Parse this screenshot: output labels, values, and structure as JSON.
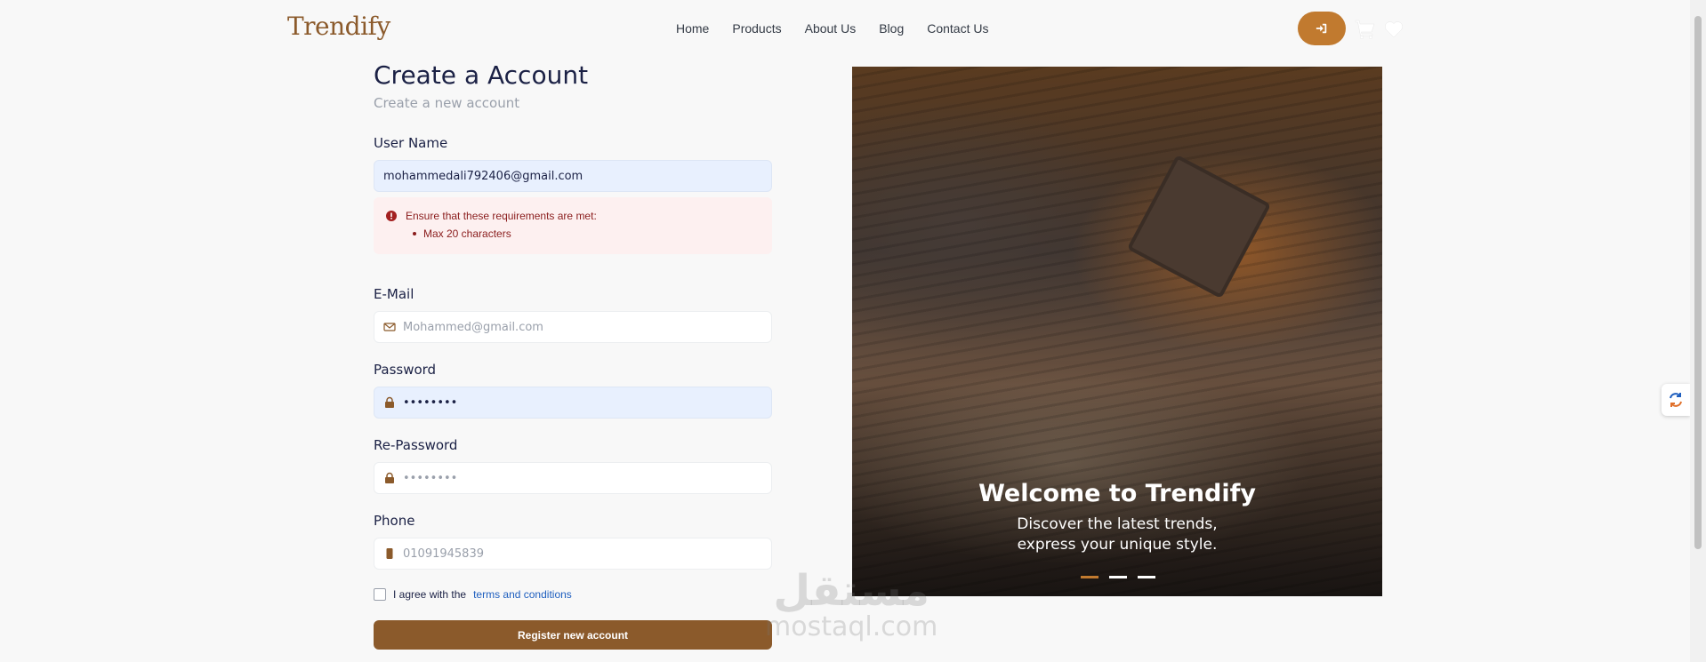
{
  "nav": {
    "brand": "Trendify",
    "links": [
      "Home",
      "Products",
      "About Us",
      "Blog",
      "Contact Us"
    ],
    "accent": "#c17a2f"
  },
  "form": {
    "title": "Create a Account",
    "subtitle": "Create a new account",
    "username": {
      "label": "User Name",
      "value": "mohammedali792406@gmail.com"
    },
    "error": {
      "heading": "Ensure that these requirements are met:",
      "items": [
        "Max 20 characters"
      ]
    },
    "email": {
      "label": "E-Mail",
      "placeholder": "Mohammed@gmail.com"
    },
    "password": {
      "label": "Password",
      "value": "••••••••"
    },
    "repassword": {
      "label": "Re-Password",
      "placeholder": "••••••••"
    },
    "phone": {
      "label": "Phone",
      "placeholder": "01091945839"
    },
    "agree": {
      "text": "I agree with the",
      "link": "terms and conditions"
    },
    "submit": "Register new account",
    "button_color": "#8b5a2b"
  },
  "hero": {
    "title": "Welcome to Trendify",
    "line1": "Discover the latest trends,",
    "line2": "express your unique style.",
    "slides": 3,
    "active_slide": 0
  },
  "watermark": {
    "arabic": "مستقل",
    "latin": "mostaql.com"
  }
}
